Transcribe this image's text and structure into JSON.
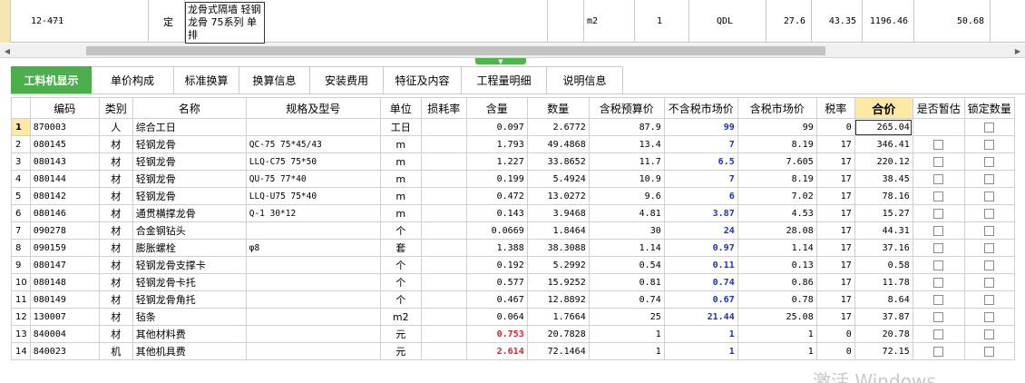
{
  "quota_row": {
    "code": "12-471",
    "type": "定",
    "name": "龙骨式隔墙 轻钢龙骨 75系列 单排",
    "unit": "m2",
    "qty": "1",
    "flag": "QDL",
    "v1": "27.6",
    "v2": "43.35",
    "v3": "1196.46",
    "v4": "50.68"
  },
  "tabs": [
    {
      "label": "工料机显示",
      "active": true
    },
    {
      "label": "单价构成"
    },
    {
      "label": "标准换算"
    },
    {
      "label": "换算信息"
    },
    {
      "label": "安装费用"
    },
    {
      "label": "特征及内容"
    },
    {
      "label": "工程量明细"
    },
    {
      "label": "说明信息"
    }
  ],
  "columns": [
    "",
    "编码",
    "类别",
    "名称",
    "规格及型号",
    "单位",
    "损耗率",
    "含量",
    "数量",
    "含税预算价",
    "不含税市场价",
    "含税市场价",
    "税率",
    "合价",
    "是否暂估",
    "锁定数量"
  ],
  "rows": [
    {
      "n": "1",
      "code": "870003",
      "cat": "人",
      "name": "综合工日",
      "spec": "",
      "unit": "工日",
      "loss": "",
      "content": "0.097",
      "qty": "2.6772",
      "bp": "87.9",
      "mp": "99",
      "tmp": "99",
      "tax": "0",
      "total": "265.04",
      "est": false
    },
    {
      "n": "2",
      "code": "080145",
      "cat": "材",
      "name": "轻钢龙骨",
      "spec": "QC-75 75*45/43",
      "unit": "m",
      "loss": "",
      "content": "1.793",
      "qty": "49.4868",
      "bp": "13.4",
      "mp": "7",
      "tmp": "8.19",
      "tax": "17",
      "total": "346.41",
      "est": true
    },
    {
      "n": "3",
      "code": "080143",
      "cat": "材",
      "name": "轻钢龙骨",
      "spec": "LLQ-C75 75*50",
      "unit": "m",
      "loss": "",
      "content": "1.227",
      "qty": "33.8652",
      "bp": "11.7",
      "mp": "6.5",
      "tmp": "7.605",
      "tax": "17",
      "total": "220.12",
      "est": true
    },
    {
      "n": "4",
      "code": "080144",
      "cat": "材",
      "name": "轻钢龙骨",
      "spec": "QU-75 77*40",
      "unit": "m",
      "loss": "",
      "content": "0.199",
      "qty": "5.4924",
      "bp": "10.9",
      "mp": "7",
      "tmp": "8.19",
      "tax": "17",
      "total": "38.45",
      "est": true
    },
    {
      "n": "5",
      "code": "080142",
      "cat": "材",
      "name": "轻钢龙骨",
      "spec": "LLQ-U75 75*40",
      "unit": "m",
      "loss": "",
      "content": "0.472",
      "qty": "13.0272",
      "bp": "9.6",
      "mp": "6",
      "tmp": "7.02",
      "tax": "17",
      "total": "78.16",
      "est": true
    },
    {
      "n": "6",
      "code": "080146",
      "cat": "材",
      "name": "通贯横撑龙骨",
      "spec": "Q-1 30*12",
      "unit": "m",
      "loss": "",
      "content": "0.143",
      "qty": "3.9468",
      "bp": "4.81",
      "mp": "3.87",
      "tmp": "4.53",
      "tax": "17",
      "total": "15.27",
      "est": true
    },
    {
      "n": "7",
      "code": "090278",
      "cat": "材",
      "name": "合金钢钻头",
      "spec": "",
      "unit": "个",
      "loss": "",
      "content": "0.0669",
      "qty": "1.8464",
      "bp": "30",
      "mp": "24",
      "tmp": "28.08",
      "tax": "17",
      "total": "44.31",
      "est": true
    },
    {
      "n": "8",
      "code": "090159",
      "cat": "材",
      "name": "膨胀螺栓",
      "spec": "φ8",
      "unit": "套",
      "loss": "",
      "content": "1.388",
      "qty": "38.3088",
      "bp": "1.14",
      "mp": "0.97",
      "tmp": "1.14",
      "tax": "17",
      "total": "37.16",
      "est": true
    },
    {
      "n": "9",
      "code": "080147",
      "cat": "材",
      "name": "轻钢龙骨支撑卡",
      "spec": "",
      "unit": "个",
      "loss": "",
      "content": "0.192",
      "qty": "5.2992",
      "bp": "0.54",
      "mp": "0.11",
      "tmp": "0.13",
      "tax": "17",
      "total": "0.58",
      "est": true
    },
    {
      "n": "10",
      "code": "080148",
      "cat": "材",
      "name": "轻钢龙骨卡托",
      "spec": "",
      "unit": "个",
      "loss": "",
      "content": "0.577",
      "qty": "15.9252",
      "bp": "0.81",
      "mp": "0.74",
      "tmp": "0.86",
      "tax": "17",
      "total": "11.78",
      "est": true
    },
    {
      "n": "11",
      "code": "080149",
      "cat": "材",
      "name": "轻钢龙骨角托",
      "spec": "",
      "unit": "个",
      "loss": "",
      "content": "0.467",
      "qty": "12.8892",
      "bp": "0.74",
      "mp": "0.67",
      "tmp": "0.78",
      "tax": "17",
      "total": "8.64",
      "est": true
    },
    {
      "n": "12",
      "code": "130007",
      "cat": "材",
      "name": "毡条",
      "spec": "",
      "unit": "m2",
      "loss": "",
      "content": "0.064",
      "qty": "1.7664",
      "bp": "25",
      "mp": "21.44",
      "tmp": "25.08",
      "tax": "17",
      "total": "37.87",
      "est": true
    },
    {
      "n": "13",
      "code": "840004",
      "cat": "材",
      "name": "其他材料费",
      "spec": "",
      "unit": "元",
      "loss": "",
      "content": "0.753",
      "qty": "20.7828",
      "bp": "1",
      "mp": "1",
      "tmp": "1",
      "tax": "0",
      "total": "20.78",
      "est": true
    },
    {
      "n": "14",
      "code": "840023",
      "cat": "机",
      "name": "其他机具费",
      "spec": "",
      "unit": "元",
      "loss": "",
      "content": "2.614",
      "qty": "72.1464",
      "bp": "1",
      "mp": "1",
      "tmp": "1",
      "tax": "0",
      "total": "72.15",
      "est": true
    }
  ],
  "watermark": "激活 Windows",
  "colors": {
    "accent": "#4cae4c",
    "highlight": "#fde9a4",
    "blue": "#1c2fd1",
    "red": "#e0202a"
  }
}
